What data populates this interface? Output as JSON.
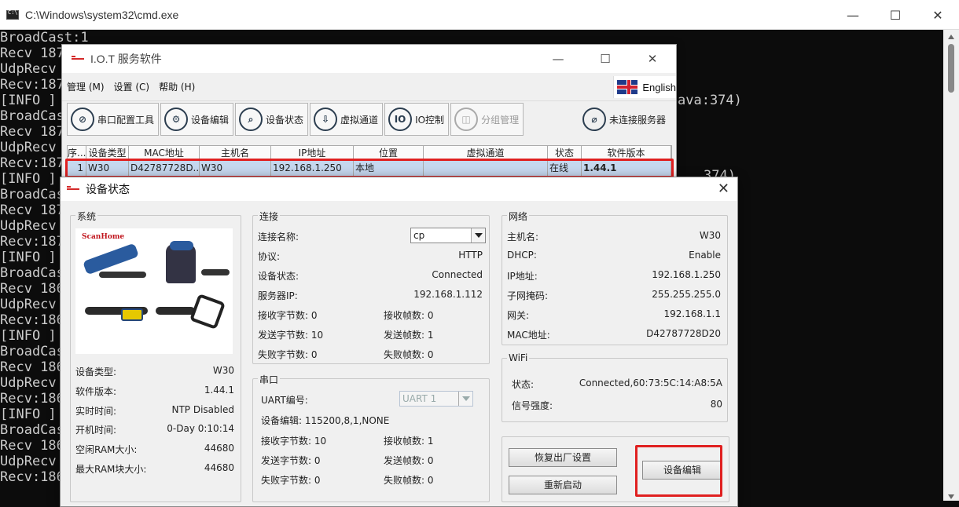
{
  "cmd": {
    "title": "C:\\Windows\\system32\\cmd.exe",
    "lines": [
      "BroadCast:1",
      "Recv 187",
      "UdpRecv",
      "Recv:187",
      "[INFO ]",
      "BroadCas",
      "Recv 187",
      "UdpRecv",
      "Recv:187",
      "[INFO ]",
      "BroadCas",
      "Recv 187",
      "UdpRecv",
      "Recv:187",
      "[INFO ]",
      "BroadCas",
      "Recv 186",
      "UdpRecv",
      "Recv:186",
      "[INFO ]",
      "BroadCas",
      "Recv 186",
      "UdpRecv",
      "Recv:186",
      "[INFO ]",
      "BroadCas",
      "Recv 186",
      "UdpRecv",
      "Recv:186"
    ],
    "frag1": "ava:374)",
    "frag2": "374)"
  },
  "iot": {
    "title": "I.O.T 服务软件",
    "menu": [
      "管理 (M)",
      "设置 (C)",
      "帮助 (H)"
    ],
    "lang": "English",
    "toolbar": [
      {
        "label": "串口配置工具",
        "icon": "link-icon"
      },
      {
        "label": "设备编辑",
        "icon": "gear-icon"
      },
      {
        "label": "设备状态",
        "icon": "search-icon"
      },
      {
        "label": "虚拟通道",
        "icon": "plug-icon"
      },
      {
        "label": "IO控制",
        "icon": "io-icon"
      },
      {
        "label": "分组管理",
        "icon": "group-icon"
      }
    ],
    "server_status": "未连接服务器",
    "table": {
      "headers": [
        "序...",
        "设备类型",
        "MAC地址",
        "主机名",
        "IP地址",
        "位置",
        "虚拟通道",
        "状态",
        "软件版本"
      ],
      "rows": [
        [
          "1",
          "W30",
          "D42787728D...",
          "W30",
          "192.168.1.250",
          "本地",
          "",
          "在线",
          "1.44.1"
        ]
      ]
    }
  },
  "dialog": {
    "title": "设备状态",
    "system": {
      "title": "系统",
      "brand": "ScanHome",
      "items": [
        {
          "k": "设备类型:",
          "v": "W30"
        },
        {
          "k": "软件版本:",
          "v": "1.44.1"
        },
        {
          "k": "实时时间:",
          "v": "NTP Disabled"
        },
        {
          "k": "开机时间:",
          "v": "0-Day 0:10:14"
        },
        {
          "k": "空闲RAM大小:",
          "v": "44680"
        },
        {
          "k": "最大RAM块大小:",
          "v": "44680"
        }
      ]
    },
    "connection": {
      "title": "连接",
      "name_label": "连接名称:",
      "name_value": "cp",
      "items": [
        {
          "k": "协议:",
          "v": "HTTP"
        },
        {
          "k": "设备状态:",
          "v": "Connected"
        },
        {
          "k": "服务器IP:",
          "v": "192.168.1.112"
        }
      ],
      "stats": [
        "接收字节数: 0",
        "接收帧数: 0",
        "发送字节数: 10",
        "发送帧数: 1",
        "失败字节数: 0",
        "失败帧数: 0"
      ]
    },
    "serial": {
      "title": "串口",
      "uart_label": "UART编号:",
      "uart_value": "UART 1",
      "edit": "设备编辑: 115200,8,1,NONE",
      "stats": [
        "接收字节数: 10",
        "接收帧数: 1",
        "发送字节数: 0",
        "发送帧数: 0",
        "失败字节数: 0",
        "失败帧数: 0"
      ]
    },
    "network": {
      "title": "网络",
      "items": [
        {
          "k": "主机名:",
          "v": "W30"
        },
        {
          "k": "DHCP:",
          "v": "Enable"
        },
        {
          "k": "IP地址:",
          "v": "192.168.1.250"
        },
        {
          "k": "子网掩码:",
          "v": "255.255.255.0"
        },
        {
          "k": "网关:",
          "v": "192.168.1.1"
        },
        {
          "k": "MAC地址:",
          "v": "D42787728D20"
        }
      ]
    },
    "wifi": {
      "title": "WiFi",
      "items": [
        {
          "k": "状态:",
          "v": "Connected,60:73:5C:14:A8:5A"
        },
        {
          "k": "信号强度:",
          "v": "80"
        }
      ]
    },
    "buttons": {
      "factory_reset": "恢复出厂设置",
      "restart": "重新启动",
      "device_edit": "设备编辑"
    }
  },
  "colors": {
    "highlight": "#e02020",
    "row_selected": "#c5d7ee"
  }
}
